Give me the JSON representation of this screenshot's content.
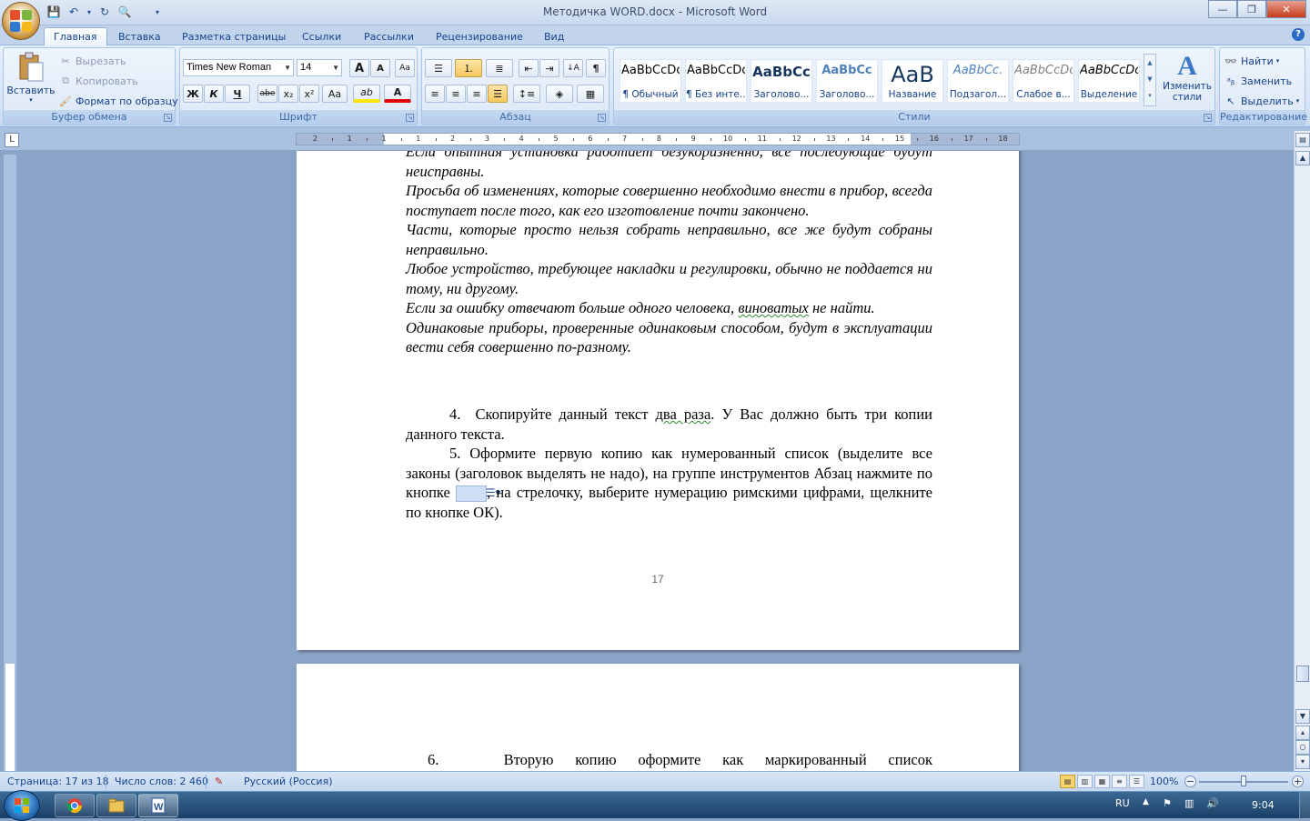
{
  "window": {
    "title": "Методичка WORD.docx - Microsoft Word",
    "minimize": "—",
    "maximize": "❐",
    "close": "✕"
  },
  "qat": {
    "save": "💾",
    "undo": "↶",
    "undo_dd": "▾",
    "redo": "↻",
    "print_preview": "🔍",
    "more": "▾"
  },
  "tabs": [
    "Главная",
    "Вставка",
    "Разметка страницы",
    "Ссылки",
    "Рассылки",
    "Рецензирование",
    "Вид"
  ],
  "active_tab": "Главная",
  "help": "?",
  "ribbon": {
    "clipboard": {
      "label": "Буфер обмена",
      "paste": "Вставить",
      "cut": "Вырезать",
      "copy": "Копировать",
      "format_painter": "Формат по образцу"
    },
    "font": {
      "label": "Шрифт",
      "font_name": "Times New Roman",
      "font_size": "14",
      "grow": "A",
      "shrink": "A",
      "clear": "Aa",
      "bold": "Ж",
      "italic": "К",
      "underline": "Ч",
      "strike": "abe",
      "sub": "x₂",
      "sup": "x²",
      "case": "Aa",
      "highlight": "ab",
      "color": "A"
    },
    "paragraph": {
      "label": "Абзац",
      "pilcrow": "¶",
      "sort": "↓A"
    },
    "styles": {
      "label": "Стили",
      "change_styles": "Изменить стили",
      "items": [
        {
          "preview": "AaBbCcDc",
          "name": "¶ Обычный"
        },
        {
          "preview": "AaBbCcDc",
          "name": "¶ Без инте..."
        },
        {
          "preview": "AaBbCc",
          "name": "Заголово..."
        },
        {
          "preview": "AaBbCc",
          "name": "Заголово..."
        },
        {
          "preview": "AaB",
          "name": "Название"
        },
        {
          "preview": "AaBbCc.",
          "name": "Подзагол..."
        },
        {
          "preview": "AaBbCcDc",
          "name": "Слабое в..."
        },
        {
          "preview": "AaBbCcDc",
          "name": "Выделение"
        }
      ]
    },
    "editing": {
      "label": "Редактирование",
      "find": "Найти",
      "replace": "Заменить",
      "select": "Выделить"
    }
  },
  "ruler": {
    "tab_selector": "L",
    "numbers": [
      "2",
      "1",
      "1",
      "1",
      "2",
      "3",
      "4",
      "5",
      "6",
      "7",
      "8",
      "9",
      "10",
      "11",
      "12",
      "13",
      "14",
      "15",
      "16",
      "17",
      "18"
    ]
  },
  "document": {
    "italic_lines": [
      "Если опытная установка работает безукоризненно, все последующие будут неисправны.",
      "Просьба об изменениях, которые совершенно необходимо внести в прибор, всегда поступает после того, как его изготовление почти закончено.",
      "Части, которые просто нельзя собрать неправильно, все же будут собраны неправильно.",
      "Любое устройство, требующее накладки и регулировки, обычно не поддается ни тому, ни другому."
    ],
    "law5_before": "Если за ошибку отвечают больше одного человека, ",
    "law5_wavy": "виноватых",
    "law5_after": " не найти.",
    "law6": "Одинаковые приборы, проверенные одинаковым способом, будут в эксплуатации вести себя совершенно по-разному.",
    "item4_pre": "4.  Скопируйте данный текст ",
    "item4_wavy": "два раза",
    "item4_post": ". У Вас должно быть три копии данного текста.",
    "item5_pre": "5. Оформите первую копию как нумерованный список (выделите все законы (заголовок выделять не надо), на группе инструментов Абзац нажмите по кнопке ",
    "item5_btn": "☰▾",
    "item5_post": ", на стрелочку, выберите нумерацию римскими цифрами, щелкните по кнопке ОК).",
    "page_number": "17",
    "page2_line": "6.   Вторую копию оформите как маркированный список"
  },
  "status": {
    "page": "Страница: 17 из 18",
    "words": "Число слов: 2 460",
    "language": "Русский (Россия)",
    "zoom": "100%",
    "zoom_minus": "−",
    "zoom_plus": "+"
  },
  "taskbar": {
    "language": "RU",
    "time": "9:04"
  }
}
